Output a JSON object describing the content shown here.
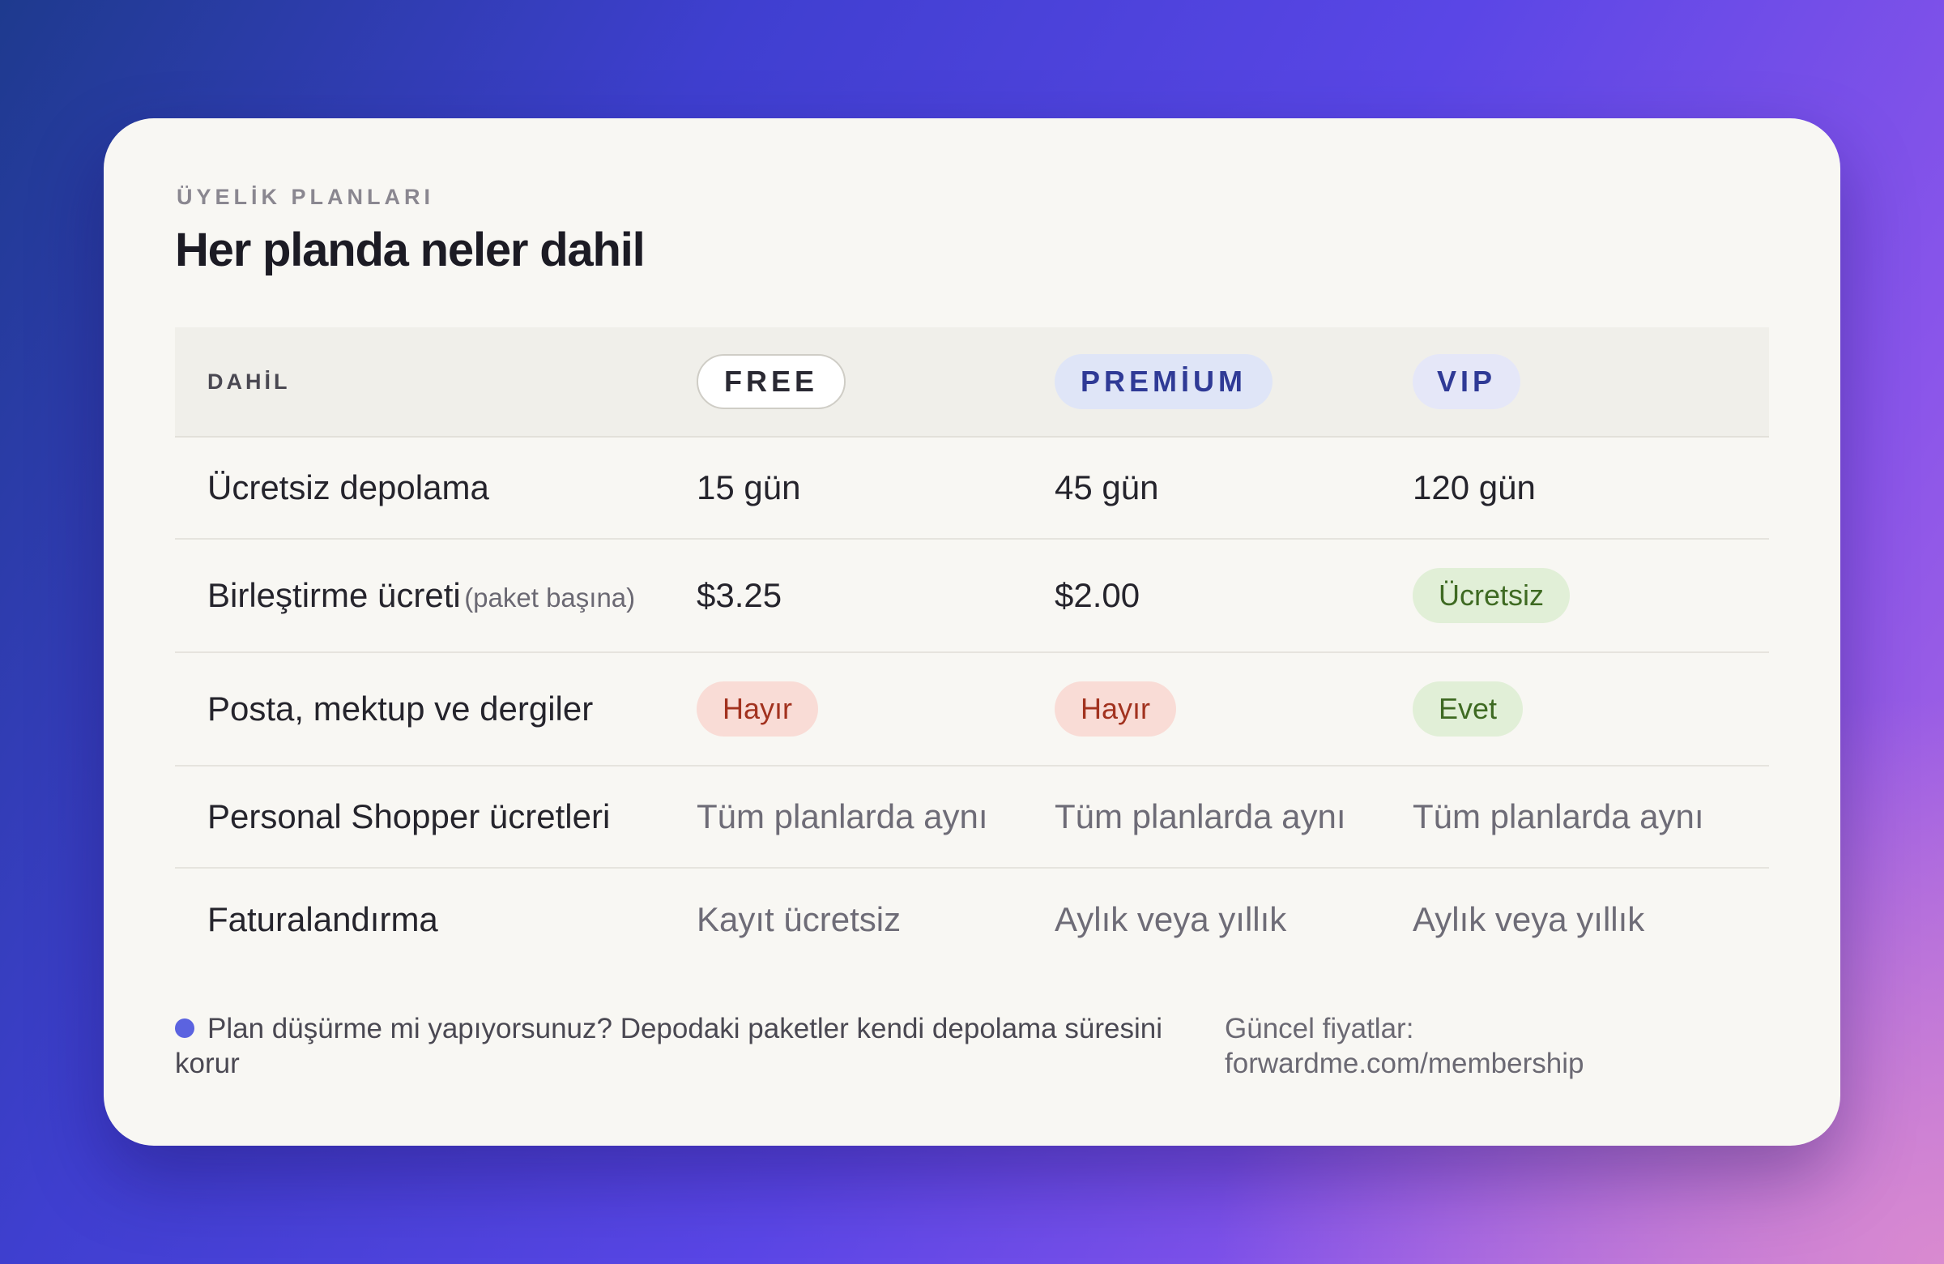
{
  "card": {
    "eyebrow": "ÜYELİK PLANLARI",
    "title": "Her planda neler dahil"
  },
  "table": {
    "header": {
      "feature_label": "DAHİL",
      "tiers": [
        "FREE",
        "PREMİUM",
        "VIP"
      ]
    },
    "rows": [
      {
        "feature": "Ücretsiz depolama",
        "note": "",
        "values": [
          "15 gün",
          "45 gün",
          "120 gün"
        ]
      },
      {
        "feature": "Birleştirme ücreti",
        "note": "(paket başına)",
        "values": [
          "$3.25",
          "$2.00",
          "Ücretsiz"
        ]
      },
      {
        "feature": "Posta, mektup ve dergiler",
        "note": "",
        "values": [
          "Hayır",
          "Hayır",
          "Evet"
        ]
      },
      {
        "feature": "Personal Shopper ücretleri",
        "note": "",
        "values": [
          "Tüm planlarda aynı",
          "Tüm planlarda aynı",
          "Tüm planlarda aynı"
        ]
      },
      {
        "feature": "Faturalandırma",
        "note": "",
        "values": [
          "Kayıt ücretsiz",
          "Aylık veya yıllık",
          "Aylık veya yıllık"
        ]
      }
    ]
  },
  "footer": {
    "note": "Plan düşürme mi yapıyorsunuz? Depodaki paketler kendi depolama süresini korur",
    "prices_label": "Güncel fiyatlar:",
    "prices_url": "forwardme.com/membership"
  },
  "colors": {
    "accent_dot": "#5b63e0",
    "no_pill_bg": "#f9dcd6",
    "no_pill_text": "#a2321f",
    "yes_pill_bg": "#e1efd7",
    "yes_pill_text": "#3e6a22",
    "tier_badge_text": "#2f3a96"
  }
}
